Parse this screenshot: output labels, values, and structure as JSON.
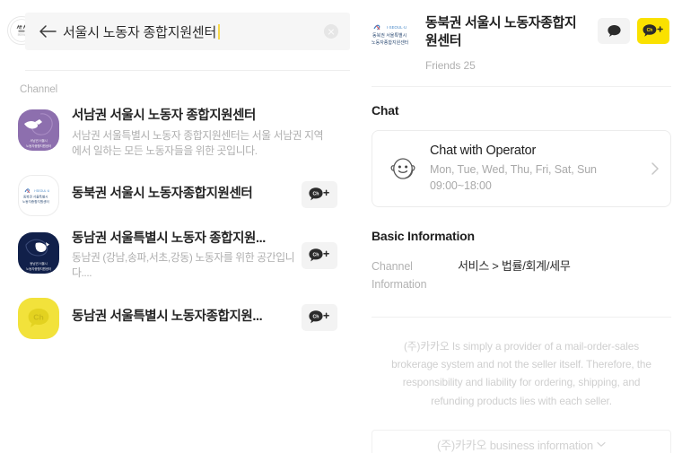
{
  "search": {
    "query": "서울시 노동자 종합지원센터",
    "placeholder": "서울시 노동자 종합지원센터",
    "back_label": "Back",
    "clear_label": "Clear"
  },
  "results": {
    "section_label": "Channel",
    "items": [
      {
        "title": "서남권 서울시 노동자 종합지원센터",
        "desc": "서남권 서울특별시 노동자 종합지원센터는 서울 서남권 지역에서 일하는 모든 노동자들을 위한 곳입니다.",
        "avatar_style": "purple",
        "avatar_caption": "서남권 서울시\\n노동자종합지원센터",
        "has_add_button": false
      },
      {
        "title": "동북권 서울시 노동자종합지원센터",
        "desc": "",
        "avatar_style": "white",
        "avatar_caption": "동북권 서울특별시\\n노동자종합지원센터",
        "has_add_button": true
      },
      {
        "title": "동남권 서울특별시 노동자 종합지원...",
        "desc": "동남권 (강남,송파,서초,강동) 노동자를 위한 공간입니다....",
        "avatar_style": "navy",
        "avatar_caption": "동남권 서울시\\n노동자종합지원센터",
        "has_add_button": true
      },
      {
        "title": "동남권 서울특별시 노동자종합지원...",
        "desc": "",
        "avatar_style": "yellow",
        "avatar_caption": "Ch",
        "has_add_button": true
      }
    ]
  },
  "detail": {
    "title": "동북권 서울시 노동자종합지원센터",
    "friends": "Friends 25",
    "logo_lines": [
      "I-SEOUL-U",
      "동북권 서울특별시",
      "노동자종합지원센터"
    ],
    "chat_section_title": "Chat",
    "chat_card": {
      "title": "Chat with Operator",
      "days": "Mon, Tue, Wed, Thu, Fri, Sat, Sun",
      "hours": "09:00~18:00"
    },
    "basic_info_title": "Basic Information",
    "info_rows": [
      {
        "key": "Channel Information",
        "value": "서비스 > 법률/회계/세무"
      }
    ],
    "disclaimer": "(주)카카오 Is simply a provider of a mail-order-sales brokerage system and not the seller itself. Therefore, the responsibility and liability for ordering, shipping, and refunding products lies with each seller.",
    "business_button": "(주)카카오 business information"
  },
  "colors": {
    "brand_yellow": "#fae100",
    "caret_yellow": "#f7d94c",
    "avatar_purple": "#8d6fae",
    "avatar_navy": "#11204a",
    "avatar_yellow": "#f2e23b",
    "text_primary": "#1f1f1f",
    "text_muted": "#b0b0b0"
  }
}
